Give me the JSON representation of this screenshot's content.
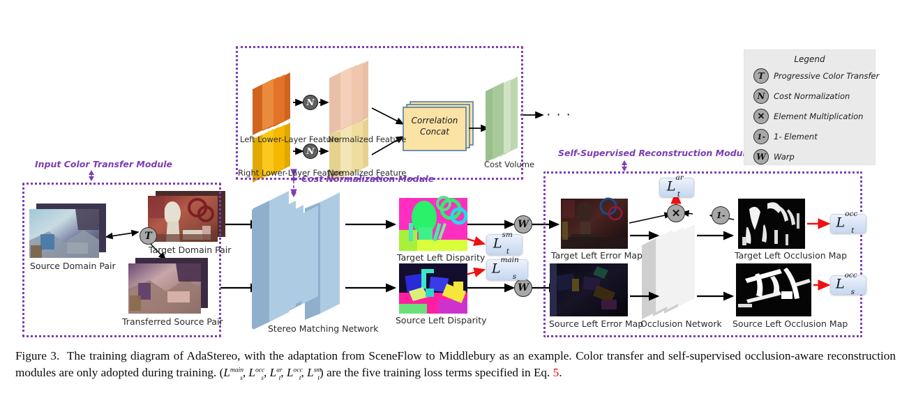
{
  "figure": {
    "number": "Figure 3.",
    "caption_part1": "The training diagram of AdaStereo, with the adaptation from SceneFlow to Middlebury as an example. Color transfer and self-supervised occlusion-aware reconstruction modules are only adopted during training. (",
    "caption_part2": ") are the five training loss terms specified in Eq. ",
    "eq_ref": "5",
    "caption_end": "."
  },
  "modules": {
    "input_color_transfer": {
      "title": "Input Color Transfer Module"
    },
    "cost_normalization": {
      "title": "Cost Normalization Module"
    },
    "self_supervised": {
      "title": "Self-Supervised Reconstruction Module"
    }
  },
  "legend": {
    "title": "Legend",
    "items": [
      {
        "symbol": "T",
        "label": "Progressive Color Transfer",
        "icon": "color-transfer-icon"
      },
      {
        "symbol": "N",
        "label": "Cost Normalization",
        "icon": "cost-normalization-icon"
      },
      {
        "symbol": "✕",
        "label": "Element Multiplication",
        "icon": "multiply-icon"
      },
      {
        "symbol": "1-",
        "label": "1- Element",
        "icon": "one-minus-icon"
      },
      {
        "symbol": "W",
        "label": "Warp",
        "icon": "warp-icon"
      }
    ]
  },
  "color_transfer_module": {
    "source_pair_label": "Source Domain Pair",
    "target_pair_label": "Target Domain Pair",
    "transferred_pair_label": "Transferred Source Pair",
    "operator": "T"
  },
  "cost_norm_module": {
    "left_feature_label": "Left Lower-Layer Feature",
    "left_normalized_label": "Normalized Feature",
    "right_feature_label": "Right Lower-Layer Feature",
    "right_normalized_label": "Normalized Feature",
    "correlation_box_line1": "Correlation",
    "correlation_box_line2": "Concat",
    "cost_volume_label": "Cost Volume",
    "ellipsis": "· · ·",
    "operator": "N"
  },
  "stereo": {
    "network_label": "Stereo Matching Network",
    "target_disparity_label": "Target Left Disparity",
    "source_disparity_label": "Source Left Disparity"
  },
  "reconstruction": {
    "target_error_label": "Target Left Error Map",
    "source_error_label": "Source Left Error Map",
    "occlusion_network_label": "Occlusion Network",
    "target_occlusion_label": "Target Left Occlusion Map",
    "source_occlusion_label": "Source Left Occlusion Map"
  },
  "losses": {
    "t_sm": {
      "base": "L",
      "sup": "sm",
      "sub": "t"
    },
    "s_main": {
      "base": "L",
      "sup": "main",
      "sub": "s"
    },
    "t_ar": {
      "base": "L",
      "sup": "ar",
      "sub": "t"
    },
    "t_occ": {
      "base": "L",
      "sup": "occ",
      "sub": "t"
    },
    "s_occ": {
      "base": "L",
      "sup": "occ",
      "sub": "s"
    }
  },
  "colors": {
    "module_border": "#7e3cb5",
    "module_title": "#7b3cb0",
    "loss_arrow": "#ee1111",
    "flow_arrow": "#000000",
    "stereo_slab_face": "#aecbe4",
    "stereo_slab_side": "#8fb0cc",
    "occlusion_slab_face": "#f2f2f2",
    "occlusion_slab_side": "#cfcfcf",
    "feature_orange": "#e2742a",
    "feature_orange_light": "#f0c6ac",
    "feature_yellow": "#f5b800",
    "feature_yellow_light": "#efdda0",
    "cost_volume_green": "#a8c99a",
    "correlation_fill": "#fbe3a5",
    "correlation_border": "#4f7ba7",
    "legend_bg": "#eaeaea",
    "operator_fill": "#a8a8a8",
    "eq_ref": "#e60000"
  }
}
